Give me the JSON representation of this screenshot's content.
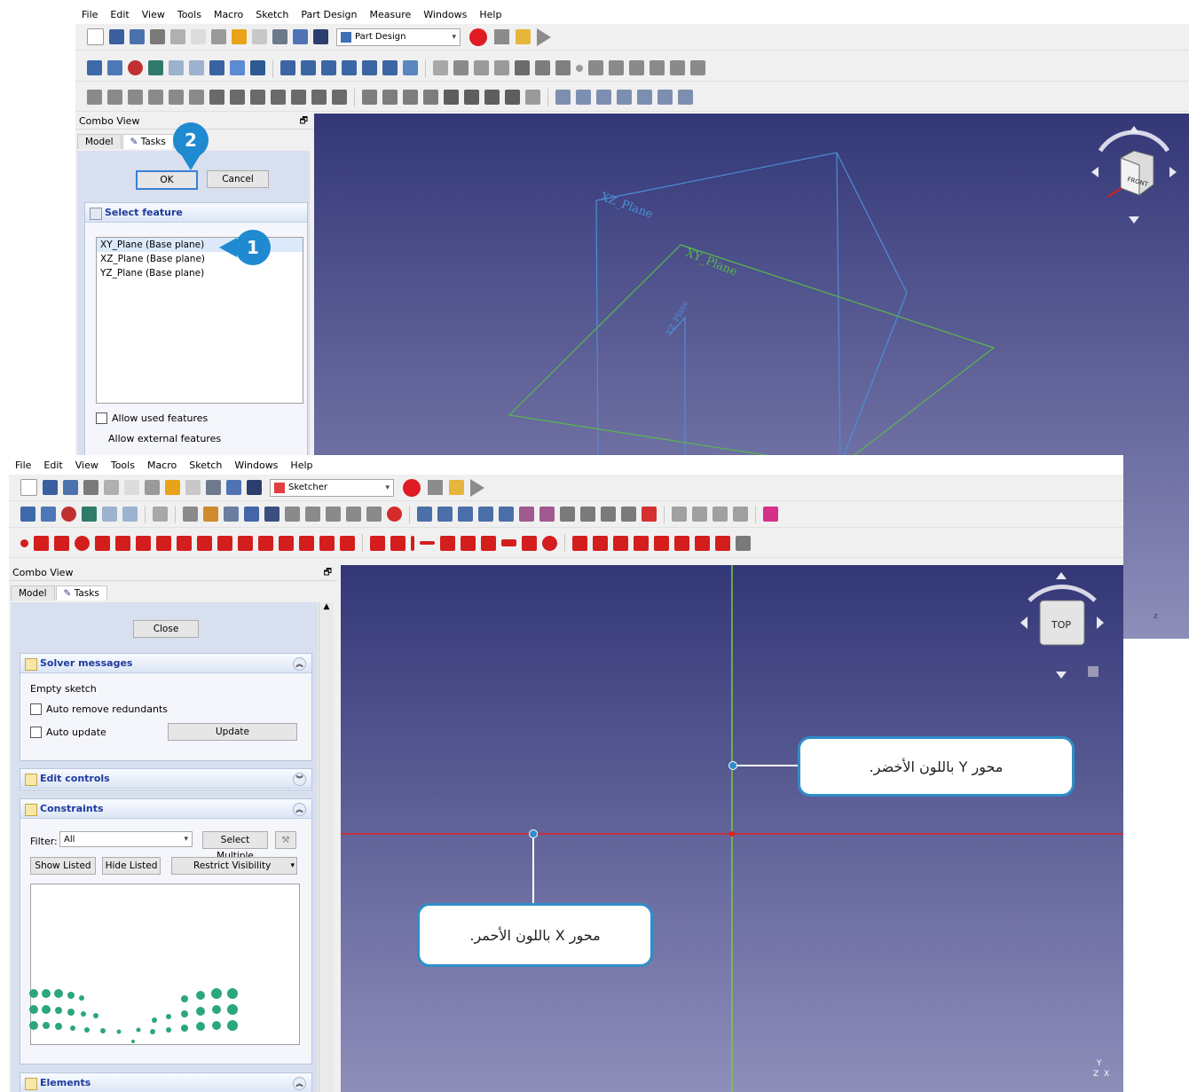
{
  "top_window": {
    "menu": [
      "File",
      "Edit",
      "View",
      "Tools",
      "Macro",
      "Sketch",
      "Part Design",
      "Measure",
      "Windows",
      "Help"
    ],
    "workbench": "Part Design",
    "combo_view_title": "Combo View",
    "tabs": [
      "Model",
      "Tasks"
    ],
    "ok_label": "OK",
    "cancel_label": "Cancel",
    "select_feature_title": "Select feature",
    "features": [
      "XY_Plane (Base plane)",
      "XZ_Plane (Base plane)",
      "YZ_Plane (Base plane)"
    ],
    "allow_used": "Allow used features",
    "allow_external": "Allow external features",
    "plane_labels": {
      "xz": "XZ_Plane",
      "xy": "XY_Plane",
      "yz": "YZ_Plane"
    },
    "navcube_face": "FRONT"
  },
  "bottom_window": {
    "menu": [
      "File",
      "Edit",
      "View",
      "Tools",
      "Macro",
      "Sketch",
      "Windows",
      "Help"
    ],
    "workbench": "Sketcher",
    "combo_view_title": "Combo View",
    "tabs": [
      "Model",
      "Tasks"
    ],
    "close_label": "Close",
    "solver": {
      "title": "Solver messages",
      "status": "Empty sketch",
      "auto_remove": "Auto remove redundants",
      "auto_update": "Auto update",
      "update_button": "Update"
    },
    "edit_controls_title": "Edit controls",
    "constraints": {
      "title": "Constraints",
      "filter_label": "Filter:",
      "filter_value": "All",
      "select_multiple": "Select Multiple",
      "show_listed": "Show Listed",
      "hide_listed": "Hide Listed",
      "restrict_visibility": "Restrict Visibility"
    },
    "elements_title": "Elements",
    "navcube_face": "TOP"
  },
  "annotations": {
    "badge_1": "1",
    "badge_2": "2",
    "callout_y": "محور Y باللون الأخضر.",
    "callout_x": "محور X باللون الأحمر."
  },
  "colors": {
    "x_axis": "#e02020",
    "y_axis": "#7ac943",
    "callout_border": "#2e8ec9",
    "badge": "#1f8ad0",
    "logo_green": "#2ba779"
  }
}
